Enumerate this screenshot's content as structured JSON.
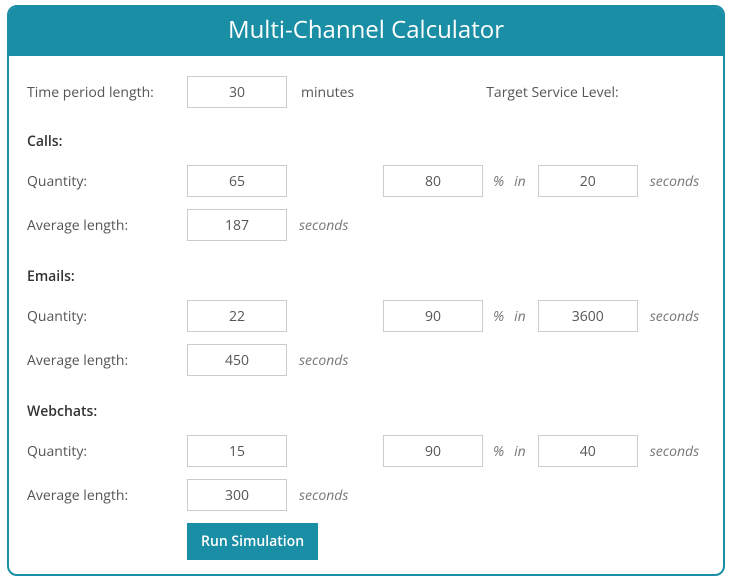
{
  "header": {
    "title": "Multi-Channel Calculator"
  },
  "top": {
    "time_label": "Time period length:",
    "time_value": "30",
    "time_unit": "minutes",
    "target_label": "Target Service Level:"
  },
  "units": {
    "seconds": "seconds",
    "pct": "%",
    "in": "in"
  },
  "labels": {
    "quantity": "Quantity:",
    "avg_length": "Average length:"
  },
  "channels": {
    "calls": {
      "title": "Calls:",
      "quantity": "65",
      "avg_length": "187",
      "sl_pct": "80",
      "sl_seconds": "20"
    },
    "emails": {
      "title": "Emails:",
      "quantity": "22",
      "avg_length": "450",
      "sl_pct": "90",
      "sl_seconds": "3600"
    },
    "webchats": {
      "title": "Webchats:",
      "quantity": "15",
      "avg_length": "300",
      "sl_pct": "90",
      "sl_seconds": "40"
    }
  },
  "actions": {
    "run_label": "Run Simulation"
  }
}
